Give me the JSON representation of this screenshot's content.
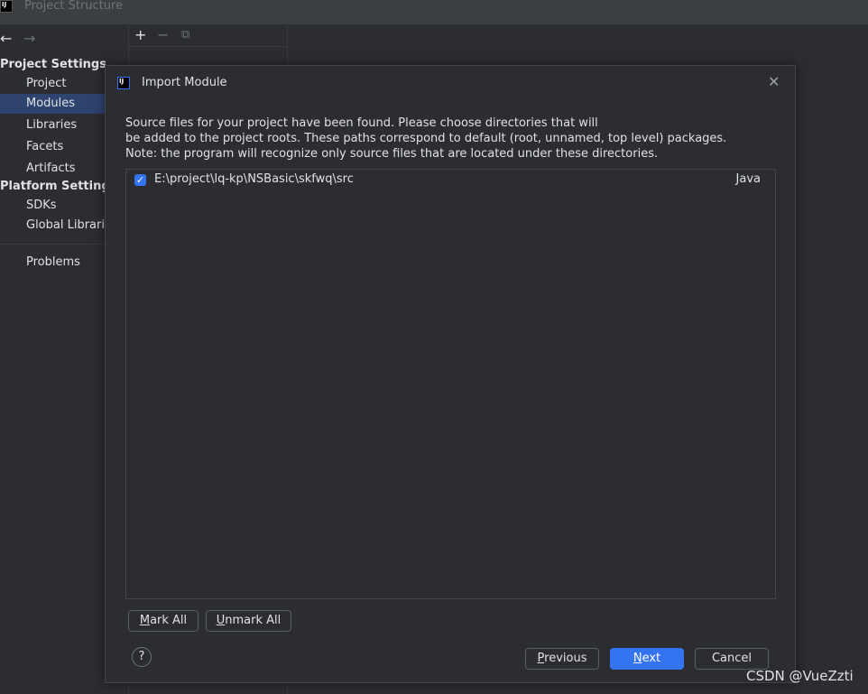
{
  "window": {
    "title": "Project Structure",
    "app_icon_text": "IJ"
  },
  "nav": {
    "back": "←",
    "forward": "→"
  },
  "sidebar": {
    "project_settings": "Project Settings",
    "platform_settings": "Platform Settings",
    "items": [
      {
        "label": "Project"
      },
      {
        "label": "Modules"
      },
      {
        "label": "Libraries"
      },
      {
        "label": "Facets"
      },
      {
        "label": "Artifacts"
      },
      {
        "label": "SDKs"
      },
      {
        "label": "Global Libraries"
      },
      {
        "label": "Problems"
      }
    ]
  },
  "midtoolbar": {
    "add": "+",
    "remove": "−",
    "copy": "⧉"
  },
  "dialog": {
    "icon_text": "IJ",
    "title": "Import Module",
    "close": "✕",
    "description": [
      "Source files for your project have been found. Please choose directories that will",
      "be added to the project roots. These paths correspond to default (root, unnamed, top level) packages.",
      "Note: the program will recognize only source files that are located under these directories."
    ],
    "rows": [
      {
        "checked": true,
        "check_glyph": "✓",
        "path": "E:\\project\\lq-kp\\NSBasic\\skfwq\\src",
        "language": "Java"
      }
    ],
    "mark_all": {
      "mnemonic": "M",
      "rest": "ark All"
    },
    "unmark_all": {
      "mnemonic": "U",
      "rest": "nmark All"
    },
    "help": "?",
    "previous": {
      "mnemonic": "P",
      "rest": "revious"
    },
    "next": {
      "mnemonic": "N",
      "rest": "ext"
    },
    "cancel": "Cancel"
  },
  "watermark": "CSDN @VueZzti",
  "colors": {
    "accent": "#3574f0",
    "selected_bg": "#2e436e",
    "background": "#2b2d30"
  }
}
